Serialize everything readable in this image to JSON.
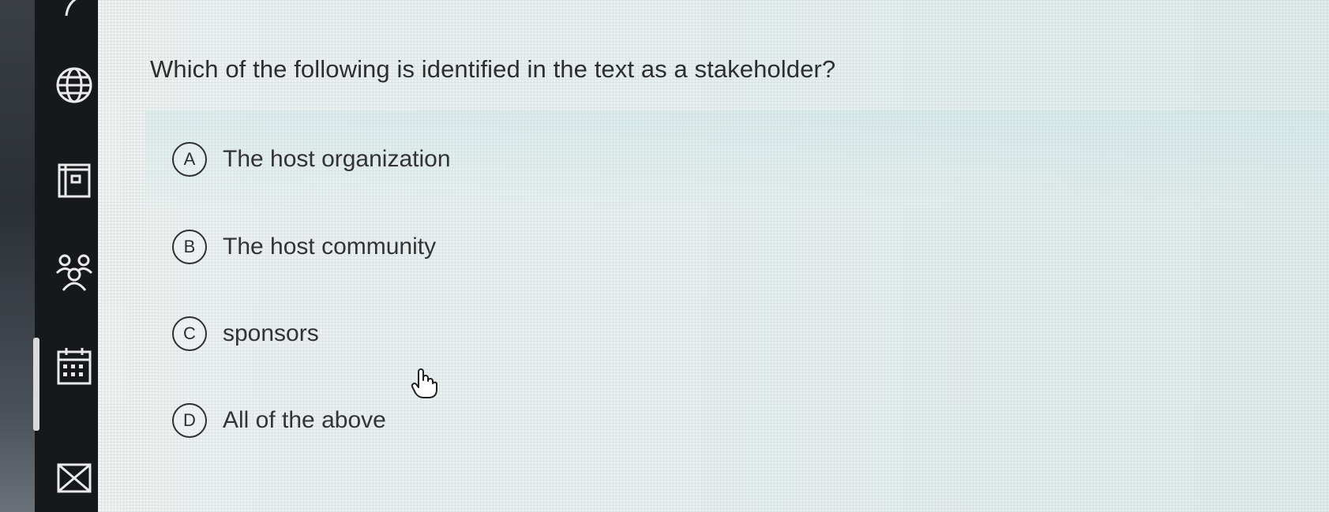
{
  "quiz": {
    "question": "Which of the following is identified in the text as a stakeholder?",
    "options": [
      {
        "letter": "A",
        "text": "The host organization"
      },
      {
        "letter": "B",
        "text": "The host community"
      },
      {
        "letter": "C",
        "text": "sponsors"
      },
      {
        "letter": "D",
        "text": "All of the above"
      }
    ]
  },
  "sidebar": {
    "icons": [
      "globe-icon",
      "notebook-icon",
      "people-icon",
      "calendar-icon",
      "mail-icon"
    ],
    "active": "calendar-icon"
  },
  "colors": {
    "sidebar_bg": "#16181b",
    "content_bg": "#eef2f1",
    "text": "#2e2e2e"
  }
}
